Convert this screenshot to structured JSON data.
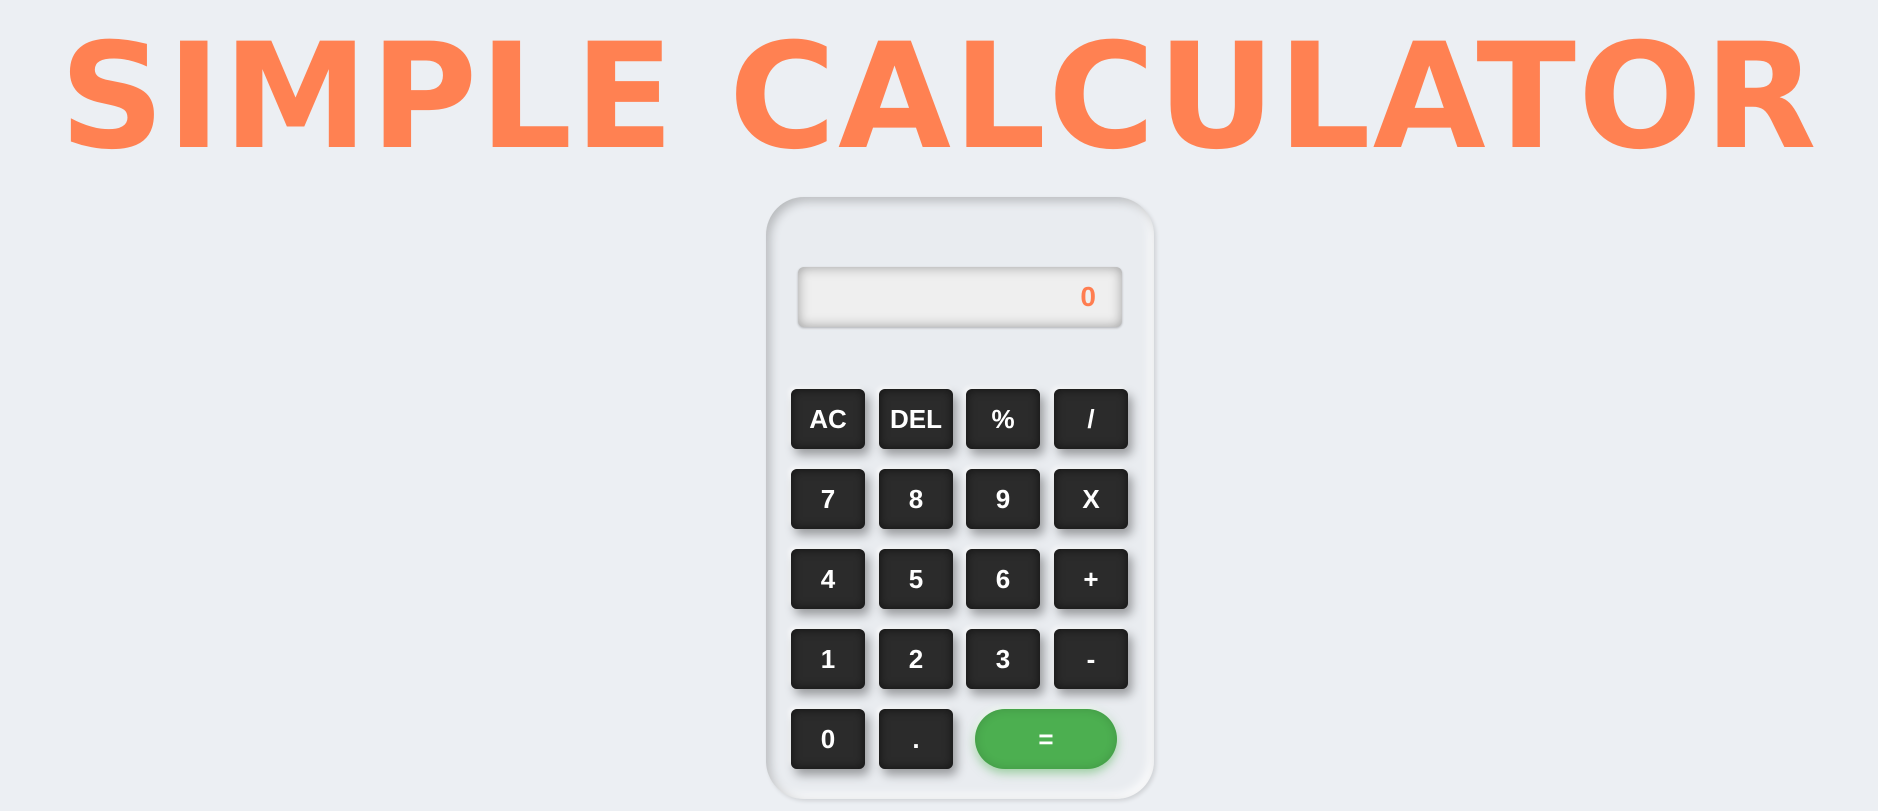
{
  "title": "SIMPLE CALCULATOR",
  "display": {
    "value": "0"
  },
  "keys": {
    "ac": "AC",
    "del": "DEL",
    "percent": "%",
    "divide": "/",
    "seven": "7",
    "eight": "8",
    "nine": "9",
    "multiply": "X",
    "four": "4",
    "five": "5",
    "six": "6",
    "plus": "+",
    "one": "1",
    "two": "2",
    "three": "3",
    "minus": "-",
    "zero": "0",
    "decimal": ".",
    "equals": "="
  },
  "colors": {
    "title": "#ff8152",
    "display_text": "#ff7d50",
    "key_background": "#2b2b2b",
    "equals_background": "#4caf50",
    "page_background": "#eceff3"
  }
}
